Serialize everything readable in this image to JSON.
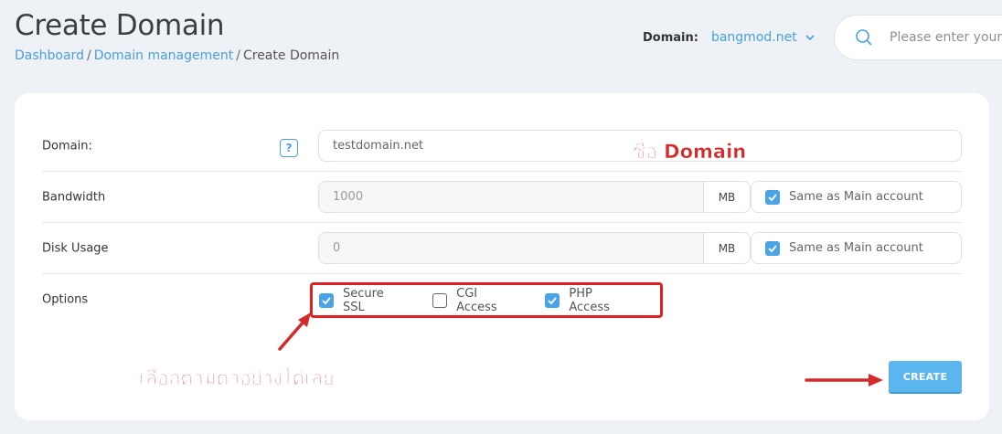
{
  "header": {
    "title": "Create Domain",
    "breadcrumb": [
      {
        "label": "Dashboard"
      },
      {
        "label": "Domain management"
      },
      {
        "label": "Create Domain"
      }
    ],
    "domain_label": "Domain:",
    "domain_value": "bangmod.net",
    "search_placeholder": "Please enter your"
  },
  "form": {
    "domain": {
      "label": "Domain:",
      "help": "?",
      "value": "testdomain.net"
    },
    "bandwidth": {
      "label": "Bandwidth",
      "value": "1000",
      "unit": "MB",
      "same_label": "Same as Main account",
      "same_checked": true
    },
    "disk_usage": {
      "label": "Disk Usage",
      "value": "0",
      "unit": "MB",
      "same_label": "Same as Main account",
      "same_checked": true
    },
    "options": {
      "label": "Options",
      "items": [
        {
          "label": "Secure SSL",
          "checked": true
        },
        {
          "label": "CGI Access",
          "checked": false
        },
        {
          "label": "PHP Access",
          "checked": true
        }
      ]
    },
    "create_label": "CREATE"
  },
  "annotations": {
    "domain_name": "ชื่อ Domain",
    "choose_example": "เลือกตามตัวอย่างได้เลย",
    "color": "#d42a2a"
  },
  "colors": {
    "accent": "#4a9fde",
    "button": "#5bb6ef",
    "highlight": "#e02020"
  }
}
